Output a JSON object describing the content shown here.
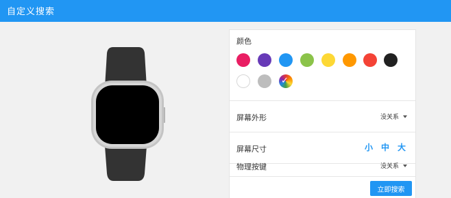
{
  "header": {
    "title": "自定义搜索"
  },
  "color_section": {
    "label": "颜色",
    "swatches": [
      {
        "name": "pink",
        "color": "#e91e63"
      },
      {
        "name": "purple",
        "color": "#673ab7"
      },
      {
        "name": "blue",
        "color": "#2196f3"
      },
      {
        "name": "green",
        "color": "#8bc34a"
      },
      {
        "name": "yellow",
        "color": "#fdd835"
      },
      {
        "name": "orange",
        "color": "#ff9800"
      },
      {
        "name": "red",
        "color": "#f44336"
      },
      {
        "name": "black",
        "color": "#212121"
      },
      {
        "name": "white",
        "color": "#ffffff"
      },
      {
        "name": "gray",
        "color": "#bdbdbd"
      },
      {
        "name": "rainbow",
        "color": "multicolor",
        "selected": true
      }
    ]
  },
  "screen_shape": {
    "label": "屏幕外形",
    "value": "没关系"
  },
  "screen_size": {
    "label": "屏幕尺寸",
    "options": [
      "小",
      "中",
      "大"
    ]
  },
  "physical_buttons": {
    "label": "物理按键",
    "value": "没关系"
  },
  "actions": {
    "search_label": "立即搜索"
  },
  "preview": {
    "strap_color": "#333333",
    "case_color": "#c4c4c4",
    "screen_color": "#000000"
  }
}
